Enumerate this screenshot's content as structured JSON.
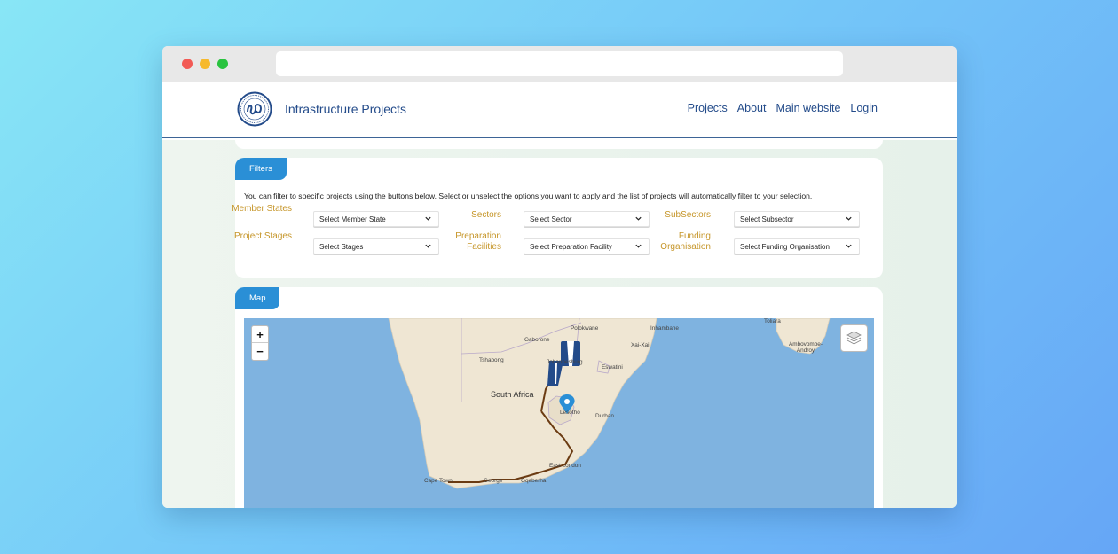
{
  "browser": {
    "url": ""
  },
  "header": {
    "brand": "Infrastructure Projects",
    "nav": [
      {
        "label": "Projects"
      },
      {
        "label": "About"
      },
      {
        "label": "Main website"
      },
      {
        "label": "Login"
      }
    ]
  },
  "filters": {
    "tab_label": "Filters",
    "intro": "You can filter to specific projects using the buttons below. Select or unselect the options you want to apply and the list of projects will automatically filter to your selection.",
    "row1": [
      {
        "label": "Member States",
        "value": "Select Member State"
      },
      {
        "label": "Sectors",
        "value": "Select Sector"
      },
      {
        "label": "SubSectors",
        "value": "Select Subsector"
      }
    ],
    "row2": [
      {
        "label": "Project Stages",
        "value": "Select Stages"
      },
      {
        "label": "Preparation Facilities",
        "value": "Select Preparation Facility"
      },
      {
        "label": "Funding Organisation",
        "value": "Select Funding Organisation"
      }
    ]
  },
  "map": {
    "tab_label": "Map",
    "zoom_in": "+",
    "zoom_out": "−",
    "place_labels": {
      "polokwane": "Polokwane",
      "inhambane": "Inhambane",
      "toliara": "Toliara",
      "gaborone": "Gaborone",
      "xai_xai": "Xai-Xai",
      "tshabong": "Tshabong",
      "johannesburg": "Johannesburg",
      "eswatini": "Eswatini",
      "ambovombe": "Ambovombe-Androy",
      "south_africa": "South Africa",
      "lesotho": "Lesotho",
      "durban": "Durban",
      "east_london": "East London",
      "cape_town": "Cape Town",
      "george": "George",
      "gqeberha": "Gqeberha"
    },
    "colors": {
      "ocean": "#7fb3e0",
      "land": "#efe6d3",
      "route": "#6b3b12",
      "marker": "#2a8fd6",
      "road_icon": "#234b8a"
    }
  }
}
